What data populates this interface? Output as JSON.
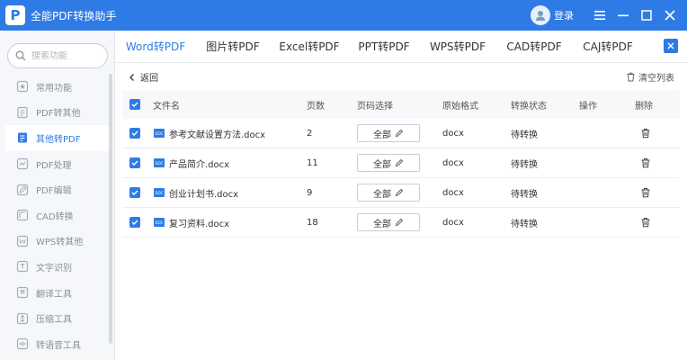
{
  "app": {
    "title": "全能PDF转换助手",
    "logo_letter": "P",
    "login": "登录"
  },
  "search": {
    "placeholder": "搜索功能"
  },
  "sidebar": {
    "items": [
      {
        "label": "常用功能",
        "icon": "star-icon"
      },
      {
        "label": "PDF转其他",
        "icon": "pdf-out-icon"
      },
      {
        "label": "其他转PDF",
        "icon": "pdf-in-icon",
        "active": true
      },
      {
        "label": "PDF处理",
        "icon": "pdf-process-icon"
      },
      {
        "label": "PDF编辑",
        "icon": "pdf-edit-icon"
      },
      {
        "label": "CAD转换",
        "icon": "cad-icon"
      },
      {
        "label": "WPS转其他",
        "icon": "wps-icon"
      },
      {
        "label": "文字识别",
        "icon": "ocr-icon"
      },
      {
        "label": "翻译工具",
        "icon": "translate-icon"
      },
      {
        "label": "压缩工具",
        "icon": "compress-icon"
      },
      {
        "label": "转语音工具",
        "icon": "voice-icon"
      }
    ]
  },
  "tabs": [
    {
      "label": "Word转PDF",
      "active": true
    },
    {
      "label": "图片转PDF"
    },
    {
      "label": "Excel转PDF"
    },
    {
      "label": "PPT转PDF"
    },
    {
      "label": "WPS转PDF"
    },
    {
      "label": "CAD转PDF"
    },
    {
      "label": "CAJ转PDF"
    }
  ],
  "toolbar": {
    "back": "返回",
    "clear": "清空列表"
  },
  "table": {
    "headers": {
      "name": "文件名",
      "pages": "页数",
      "page_select": "页码选择",
      "format": "原始格式",
      "status": "转换状态",
      "action": "操作",
      "delete": "删除"
    },
    "rows": [
      {
        "name": "参考文献设置方法.docx",
        "pages": "2",
        "page_select": "全部",
        "format": "docx",
        "status": "待转换"
      },
      {
        "name": "产品简介.docx",
        "pages": "11",
        "page_select": "全部",
        "format": "docx",
        "status": "待转换"
      },
      {
        "name": "创业计划书.docx",
        "pages": "9",
        "page_select": "全部",
        "format": "docx",
        "status": "待转换"
      },
      {
        "name": "复习资料.docx",
        "pages": "18",
        "page_select": "全部",
        "format": "docx",
        "status": "待转换"
      }
    ]
  },
  "colors": {
    "accent": "#2f7be6",
    "sidebar_bg": "#f5f7fa"
  }
}
